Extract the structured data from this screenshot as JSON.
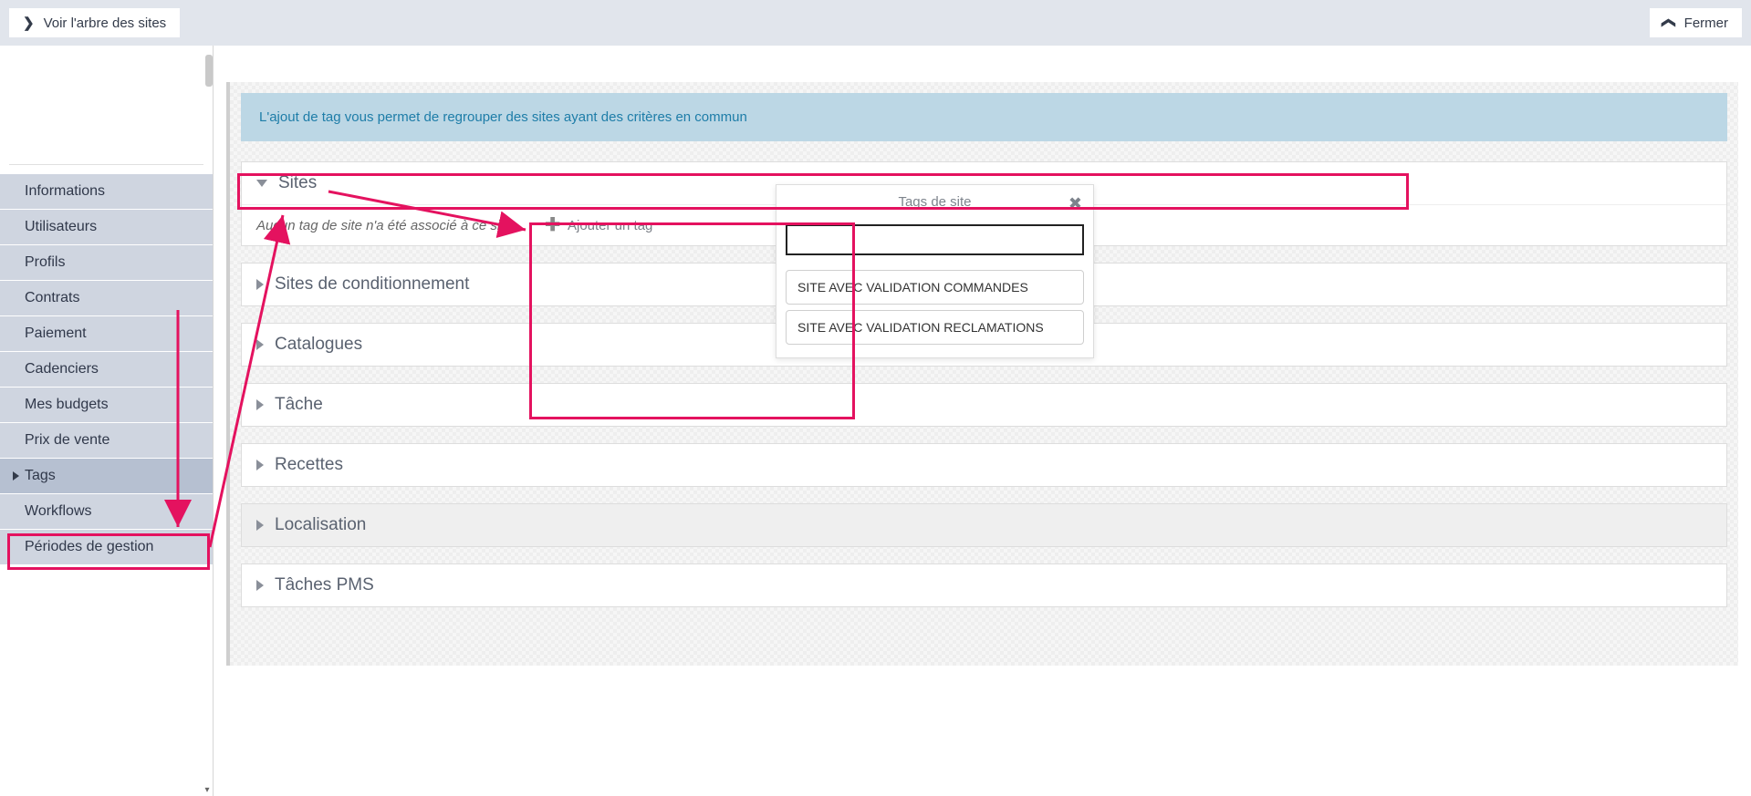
{
  "topbar": {
    "see_tree_label": "Voir l'arbre des sites",
    "close_label": "Fermer"
  },
  "sidebar": {
    "items": [
      {
        "label": "Informations"
      },
      {
        "label": "Utilisateurs"
      },
      {
        "label": "Profils"
      },
      {
        "label": "Contrats"
      },
      {
        "label": "Paiement"
      },
      {
        "label": "Cadenciers"
      },
      {
        "label": "Mes budgets"
      },
      {
        "label": "Prix de vente"
      },
      {
        "label": "Tags"
      },
      {
        "label": "Workflows"
      },
      {
        "label": "Périodes de gestion"
      }
    ]
  },
  "main": {
    "info_banner": "L'ajout de tag vous permet de regrouper des sites ayant des critères en commun",
    "sections": [
      {
        "label": "Sites",
        "expanded": true,
        "no_tag_text": "Aucun tag de site n'a été associé à ce site...",
        "add_tag_label": "Ajouter un tag"
      },
      {
        "label": "Sites de conditionnement",
        "expanded": false
      },
      {
        "label": "Catalogues",
        "expanded": false
      },
      {
        "label": "Tâche",
        "expanded": false
      },
      {
        "label": "Recettes",
        "expanded": false
      },
      {
        "label": "Localisation",
        "expanded": false,
        "gray": true
      },
      {
        "label": "Tâches PMS",
        "expanded": false
      }
    ]
  },
  "popup": {
    "title": "Tags de site",
    "input_value": "",
    "options": [
      "SITE AVEC VALIDATION COMMANDES",
      "SITE AVEC VALIDATION RECLAMATIONS"
    ]
  }
}
